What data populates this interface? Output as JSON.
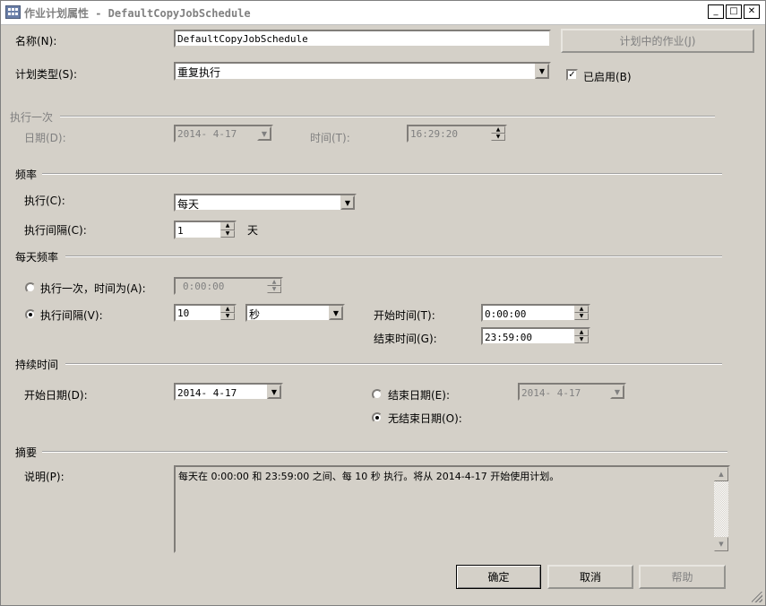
{
  "window": {
    "title": "作业计划属性 - DefaultCopyJobSchedule"
  },
  "titlebar": {
    "minimize": "_",
    "maximize": "□",
    "close": "✕"
  },
  "name": {
    "label": "名称(N):",
    "value": "DefaultCopyJobSchedule"
  },
  "jobs_in_schedule_button": "计划中的作业(J)",
  "schedule_type": {
    "label": "计划类型(S):",
    "value": "重复执行"
  },
  "enabled": {
    "label": "已启用(B)",
    "checked": true
  },
  "one_time": {
    "group": "执行一次",
    "date_label": "日期(D):",
    "date_value": "2014- 4-17",
    "time_label": "时间(T):",
    "time_value": "16:29:20"
  },
  "frequency": {
    "group": "频率",
    "occurs_label": "执行(C):",
    "occurs_value": "每天",
    "recurs_label": "执行间隔(C):",
    "recurs_value": "1",
    "recurs_unit": "天"
  },
  "daily_frequency": {
    "group": "每天频率",
    "once_label": "执行一次，时间为(A):",
    "once_value": "0:00:00",
    "every_label": "执行间隔(V):",
    "every_value": "10",
    "every_unit": "秒",
    "start_label": "开始时间(T):",
    "start_value": "0:00:00",
    "end_label": "结束时间(G):",
    "end_value": "23:59:00"
  },
  "duration": {
    "group": "持续时间",
    "start_date_label": "开始日期(D):",
    "start_date_value": "2014- 4-17",
    "end_date_label": "结束日期(E):",
    "end_date_value": "2014- 4-17",
    "no_end_label": "无结束日期(O):"
  },
  "summary": {
    "group": "摘要",
    "desc_label": "说明(P):",
    "desc_value": "每天在 0:00:00 和 23:59:00 之间、每 10 秒 执行。将从 2014-4-17 开始使用计划。"
  },
  "buttons": {
    "ok": "确定",
    "cancel": "取消",
    "help": "帮助"
  }
}
